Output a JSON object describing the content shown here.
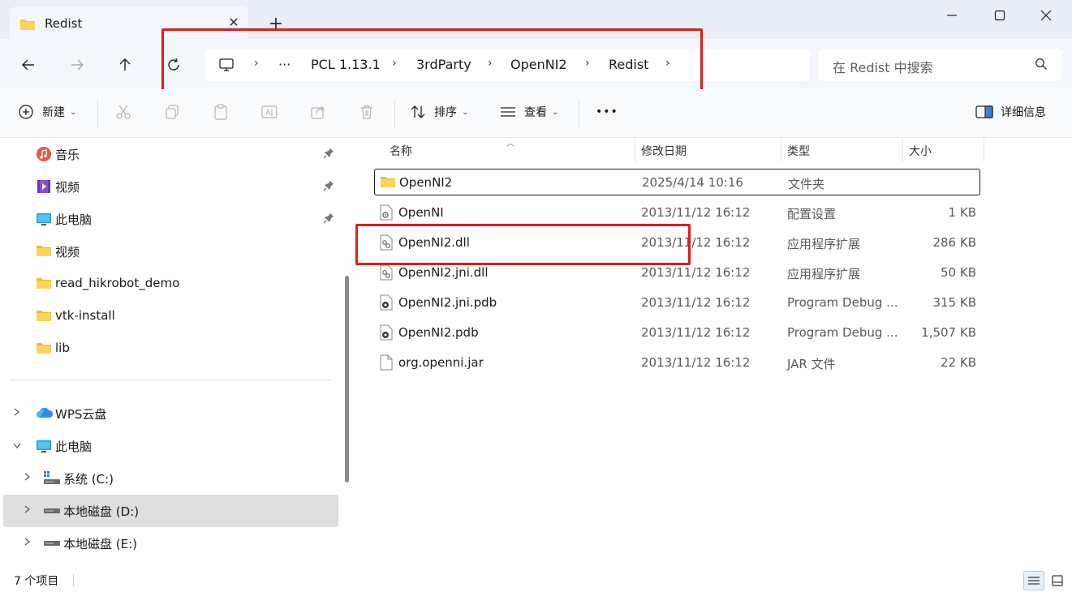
{
  "window": {
    "tab_title": "Redist",
    "new_tab_label": "+",
    "tab_close_label": "✕"
  },
  "address": {
    "overflow_label": "···",
    "crumbs": [
      "PCL 1.13.1",
      "3rdParty",
      "OpenNI2",
      "Redist"
    ]
  },
  "search": {
    "placeholder": "在 Redist 中搜索"
  },
  "toolbar": {
    "new_label": "新建",
    "sort_label": "排序",
    "view_label": "查看",
    "more_label": "•••",
    "details_label": "详细信息"
  },
  "sidebar": {
    "quick_access": [
      {
        "label": "音乐",
        "icon": "music-icon",
        "pinned": true
      },
      {
        "label": "视频",
        "icon": "video-icon",
        "pinned": true
      },
      {
        "label": "此电脑",
        "icon": "monitor-icon",
        "pinned": true
      },
      {
        "label": "视频",
        "icon": "folder-icon",
        "pinned": false
      },
      {
        "label": "read_hikrobot_demo",
        "icon": "folder-icon",
        "pinned": false
      },
      {
        "label": "vtk-install",
        "icon": "folder-icon",
        "pinned": false
      },
      {
        "label": "lib",
        "icon": "folder-icon",
        "pinned": false
      }
    ],
    "tree": [
      {
        "label": "WPS云盘",
        "icon": "cloud-icon",
        "expanded": false,
        "indent": 0
      },
      {
        "label": "此电脑",
        "icon": "monitor-icon",
        "expanded": true,
        "indent": 0
      },
      {
        "label": "系统 (C:)",
        "icon": "drive-icon",
        "expanded": false,
        "indent": 1
      },
      {
        "label": "本地磁盘 (D:)",
        "icon": "drive-icon",
        "expanded": false,
        "indent": 1,
        "selected": true
      },
      {
        "label": "本地磁盘 (E:)",
        "icon": "drive-icon",
        "expanded": false,
        "indent": 1
      }
    ]
  },
  "columns": {
    "name": "名称",
    "date": "修改日期",
    "type": "类型",
    "size": "大小"
  },
  "files": [
    {
      "name": "OpenNI2",
      "date": "2025/4/14 10:16",
      "type": "文件夹",
      "size": "",
      "icon": "folder-icon",
      "selected": true
    },
    {
      "name": "OpenNI",
      "date": "2013/11/12 16:12",
      "type": "配置设置",
      "size": "1 KB",
      "icon": "config-file-icon"
    },
    {
      "name": "OpenNI2.dll",
      "date": "2013/11/12 16:12",
      "type": "应用程序扩展",
      "size": "286 KB",
      "icon": "dll-file-icon"
    },
    {
      "name": "OpenNI2.jni.dll",
      "date": "2013/11/12 16:12",
      "type": "应用程序扩展",
      "size": "50 KB",
      "icon": "dll-file-icon"
    },
    {
      "name": "OpenNI2.jni.pdb",
      "date": "2013/11/12 16:12",
      "type": "Program Debug ...",
      "size": "315 KB",
      "icon": "pdb-file-icon"
    },
    {
      "name": "OpenNI2.pdb",
      "date": "2013/11/12 16:12",
      "type": "Program Debug ...",
      "size": "1,507 KB",
      "icon": "pdb-file-icon"
    },
    {
      "name": "org.openni.jar",
      "date": "2013/11/12 16:12",
      "type": "JAR 文件",
      "size": "22 KB",
      "icon": "file-icon"
    }
  ],
  "status": {
    "item_count": "7 个项目"
  },
  "colors": {
    "highlight": "#e11b1b",
    "folder": "#f5c443",
    "selection": "#dedede"
  }
}
